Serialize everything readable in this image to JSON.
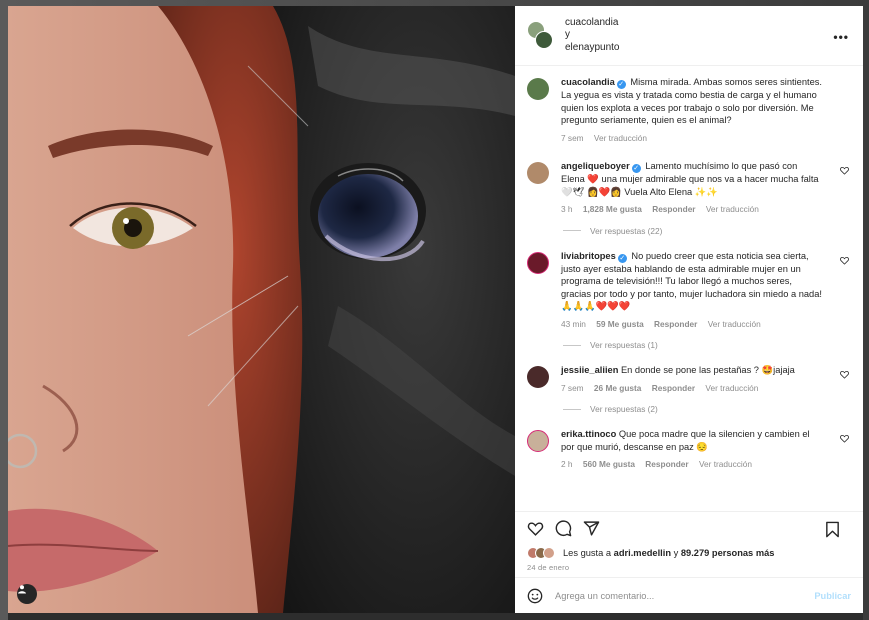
{
  "header": {
    "user1": "cuacolandia",
    "joiner": "y",
    "user2": "elenaypunto",
    "more": "•••"
  },
  "caption": {
    "username": "cuacolandia",
    "text": "Misma mirada. Ambas somos seres sintientes. La yegua es vista y tratada como bestia de carga y el humano quien los explota a veces por trabajo o solo por diversión. Me pregunto seriamente, quien es el animal?",
    "time": "7 sem",
    "translate": "Ver traducción"
  },
  "comments": [
    {
      "username": "angeliqueboyer",
      "text": "Lamento muchísimo lo que pasó con Elena ❤️ una mujer admirable que nos va a hacer mucha falta 🤍🕊 👩‍❤️👩 Vuela Alto Elena ✨✨",
      "time": "3 h",
      "likes": "1,828 Me gusta",
      "reply": "Responder",
      "translate": "Ver traducción",
      "replies": "Ver respuestas (22)"
    },
    {
      "username": "liviabritopes",
      "text": "No puedo creer que esta noticia sea cierta, justo ayer estaba hablando de esta admirable mujer en un programa de televisión!!! Tu labor llegó a muchos seres, gracias por todo y por tanto, mujer luchadora sin miedo a nada! 🙏🙏🙏❤️❤️❤️",
      "time": "43 min",
      "likes": "59 Me gusta",
      "reply": "Responder",
      "translate": "Ver traducción",
      "replies": "Ver respuestas (1)"
    },
    {
      "username": "jessiie_aliien",
      "text": "En donde se pone las pestañas ? 🤩jajaja",
      "time": "7 sem",
      "likes": "26 Me gusta",
      "reply": "Responder",
      "translate": "Ver traducción",
      "replies": "Ver respuestas (2)"
    },
    {
      "username": "erika.ttinoco",
      "text": "Que poca madre que la silencien y cambien el por que murió, descanse en paz 😔",
      "time": "2 h",
      "likes": "560 Me gusta",
      "reply": "Responder",
      "translate": "Ver traducción"
    }
  ],
  "likes": {
    "prefix": "Les gusta a ",
    "user": "adri.medellin",
    "middle": " y ",
    "count": "89.279 personas más"
  },
  "date": "24 de enero",
  "add_comment": {
    "placeholder": "Agrega un comentario...",
    "post": "Publicar"
  },
  "icons": {
    "like": "heart-icon",
    "comment": "comment-icon",
    "share": "share-icon",
    "save": "bookmark-icon",
    "emoji": "emoji-icon",
    "tag": "user-tag-icon"
  },
  "colors": {
    "verified": "#3897f0",
    "muted": "#8e8e8e",
    "post_disabled": "#b2dffc"
  }
}
